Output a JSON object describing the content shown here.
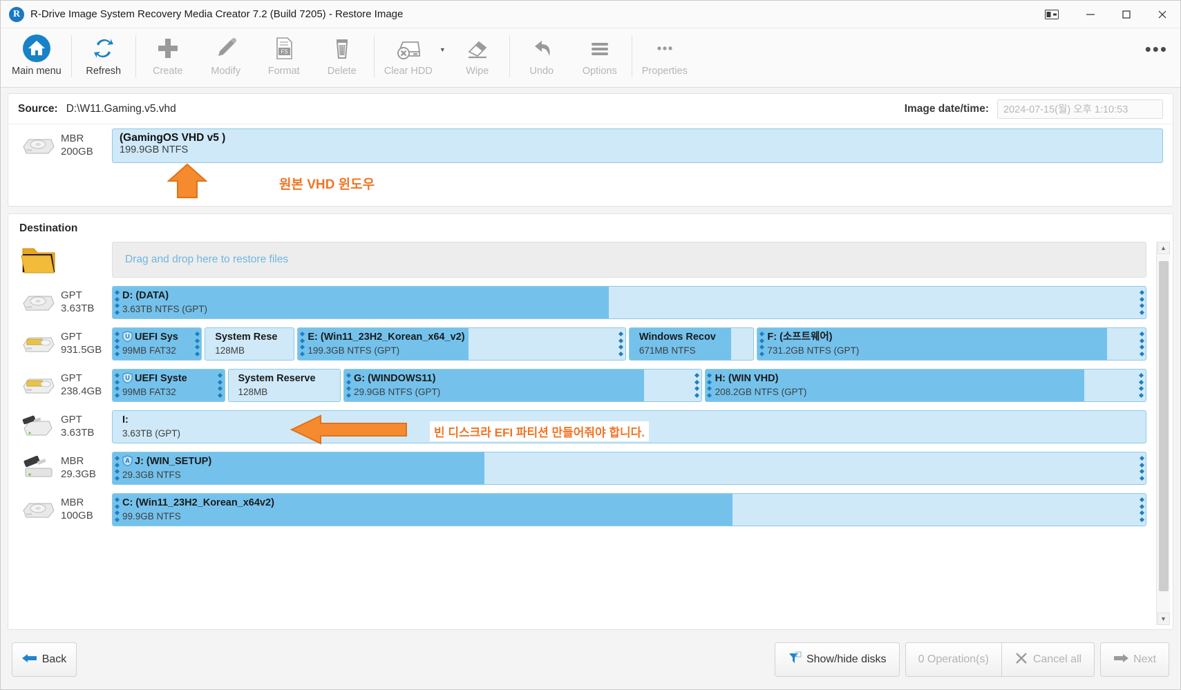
{
  "window": {
    "title": "R-Drive Image System Recovery Media Creator 7.2 (Build 7205) - Restore Image",
    "logo_letter": "R",
    "controls": {
      "restore_icon": "window-restore-icon",
      "minimize": "—",
      "maximize": "□",
      "close": "✕"
    }
  },
  "toolbar": {
    "items": [
      {
        "label": "Main menu",
        "icon": "home-icon",
        "disabled": false
      },
      {
        "label": "Refresh",
        "icon": "refresh-icon",
        "disabled": false
      },
      {
        "label": "Create",
        "icon": "plus-icon",
        "disabled": true
      },
      {
        "label": "Modify",
        "icon": "pencil-icon",
        "disabled": true
      },
      {
        "label": "Format",
        "icon": "format-fs-icon",
        "disabled": true
      },
      {
        "label": "Delete",
        "icon": "trash-icon",
        "disabled": true
      },
      {
        "label": "Clear HDD",
        "icon": "clear-hdd-icon",
        "disabled": true
      },
      {
        "label": "Wipe",
        "icon": "eraser-icon",
        "disabled": true
      },
      {
        "label": "Undo",
        "icon": "undo-arrow-icon",
        "disabled": true
      },
      {
        "label": "Options",
        "icon": "hamburger-icon",
        "disabled": true
      },
      {
        "label": "Properties",
        "icon": "ellipsis-icon",
        "disabled": true
      }
    ],
    "overflow": "•••"
  },
  "source": {
    "label": "Source:",
    "value": "D:\\W11.Gaming.v5.vhd",
    "image_datetime_label": "Image date/time:",
    "image_datetime_value": "2024-07-15(월) 오후 1:10:53",
    "disk": {
      "scheme": "MBR",
      "size": "200GB",
      "icon": "hdd-icon",
      "partition": {
        "title": "(GamingOS VHD v5 )",
        "sub": "199.9GB NTFS"
      }
    },
    "annotation": "원본 VHD 윈도우"
  },
  "destination": {
    "title": "Destination",
    "dropzone": "Drag and drop here to restore files",
    "dropzone_icon": "folder-icon",
    "annotation_i": "빈 디스크라 EFI 파티션 만들어줘야 합니다.",
    "disks": [
      {
        "scheme": "GPT",
        "size": "3.63TB",
        "icon": "hdd-icon",
        "partitions": [
          {
            "title": "D: (DATA)",
            "sub": "3.63TB NTFS (GPT)",
            "flex": 100,
            "fill": 48,
            "handles": true
          }
        ]
      },
      {
        "scheme": "GPT",
        "size": "931.5GB",
        "icon": "hdd-gold-icon",
        "partitions": [
          {
            "title": "UEFI Sys",
            "sub": "99MB FAT32",
            "flex": 7.5,
            "fill": 100,
            "handles": true,
            "shield": true
          },
          {
            "title": "System Rese",
            "sub": "128MB",
            "flex": 7.5,
            "fill": 0,
            "handles": false
          },
          {
            "title": "E: (Win11_23H2_Korean_x64_v2)",
            "sub": "199.3GB NTFS (GPT)",
            "flex": 31,
            "fill": 52,
            "handles": true
          },
          {
            "title": "Windows Recov",
            "sub": "671MB NTFS",
            "flex": 11,
            "fill": 82,
            "handles": false
          },
          {
            "title": "F: (소프트웨어)",
            "sub": "731.2GB NTFS (GPT)",
            "flex": 37,
            "fill": 90,
            "handles": true
          }
        ]
      },
      {
        "scheme": "GPT",
        "size": "238.4GB",
        "icon": "hdd-gold-icon",
        "partitions": [
          {
            "title": "UEFI Syste",
            "sub": "99MB FAT32",
            "flex": 9.5,
            "fill": 100,
            "handles": true,
            "shield": true
          },
          {
            "title": "System Reserve",
            "sub": "128MB",
            "flex": 9.5,
            "fill": 0,
            "handles": false
          },
          {
            "title": "G: (WINDOWS11)",
            "sub": "29.9GB NTFS (GPT)",
            "flex": 33,
            "fill": 84,
            "handles": true
          },
          {
            "title": "H: (WIN VHD)",
            "sub": "208.2GB NTFS (GPT)",
            "flex": 41,
            "fill": 86,
            "handles": true
          }
        ]
      },
      {
        "scheme": "GPT",
        "size": "3.63TB",
        "icon": "usb-hdd-icon",
        "partitions": [
          {
            "title": "I:",
            "sub": "3.63TB (GPT)",
            "flex": 100,
            "fill": 0,
            "handles": false,
            "empty": true
          }
        ]
      },
      {
        "scheme": "MBR",
        "size": "29.3GB",
        "icon": "usb-stick-icon",
        "partitions": [
          {
            "title": "J: (WIN_SETUP)",
            "sub": "29.3GB NTFS",
            "flex": 100,
            "fill": 36,
            "handles": true,
            "shield_a": true
          }
        ]
      },
      {
        "scheme": "MBR",
        "size": "100GB",
        "icon": "hdd-icon",
        "partitions": [
          {
            "title": "C: (Win11_23H2_Korean_x64v2)",
            "sub": "99.9GB NTFS",
            "flex": 100,
            "fill": 60,
            "handles": true
          }
        ]
      }
    ]
  },
  "footer": {
    "back": "Back",
    "show_hide_disks": "Show/hide disks",
    "operations": "0 Operation(s)",
    "cancel_all": "Cancel all",
    "next": "Next"
  },
  "colors": {
    "accent": "#1f7fc0",
    "partition_fill": "#74c2ec",
    "partition_bg": "#cfe9f8",
    "annotation": "#f07422"
  }
}
